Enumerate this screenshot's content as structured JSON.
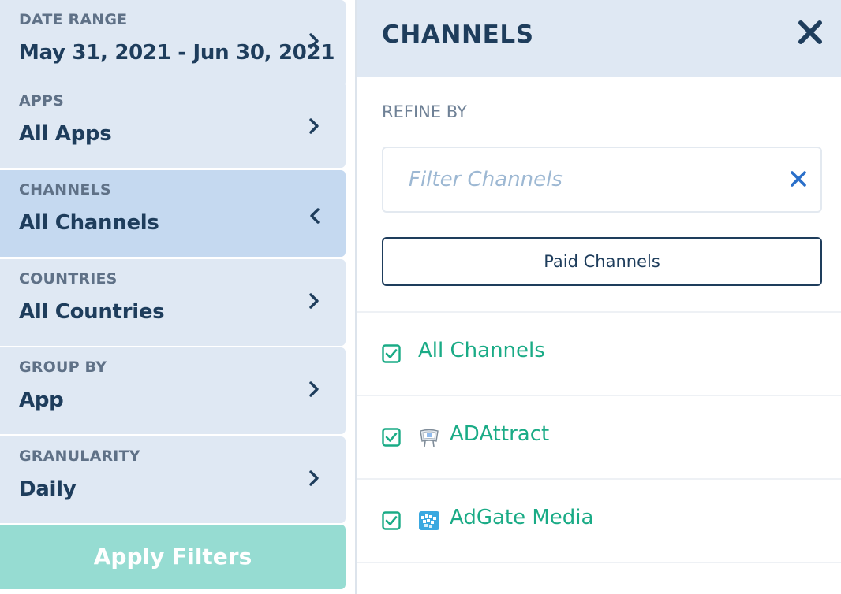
{
  "sidebar": {
    "filters": [
      {
        "label": "DATE RANGE",
        "value": "May 31, 2021 - Jun 30, 2021",
        "chevron": "chevron-right-icon"
      },
      {
        "label": "APPS",
        "value": "All Apps",
        "chevron": "chevron-right-icon"
      },
      {
        "label": "CHANNELS",
        "value": "All Channels",
        "chevron": "chevron-left-icon",
        "active": true
      },
      {
        "label": "COUNTRIES",
        "value": "All Countries",
        "chevron": "chevron-right-icon"
      },
      {
        "label": "GROUP BY",
        "value": "App",
        "chevron": "chevron-right-icon"
      },
      {
        "label": "GRANULARITY",
        "value": "Daily",
        "chevron": "chevron-right-icon"
      }
    ],
    "apply_label": "Apply Filters"
  },
  "panel": {
    "title": "CHANNELS",
    "close_icon": "close-icon",
    "refine_label": "REFINE BY",
    "search": {
      "placeholder": "Filter Channels",
      "value": "",
      "clear_icon": "clear-icon"
    },
    "paid_button_label": "Paid Channels",
    "channels": [
      {
        "label": "All Channels",
        "checked": true,
        "logo": ""
      },
      {
        "label": "ADAttract",
        "checked": true,
        "logo": "adattract-logo-icon"
      },
      {
        "label": "AdGate Media",
        "checked": true,
        "logo": "adgate-media-logo-icon"
      }
    ]
  },
  "colors": {
    "sidebar_bg": "#dfe8f3",
    "sidebar_active_bg": "#c5d9f0",
    "navy": "#1e3d5c",
    "label_gray": "#5f7187",
    "apply_bg": "#96dcd2",
    "channel_green": "#1aab86",
    "placeholder_blue": "#9db8d3"
  }
}
